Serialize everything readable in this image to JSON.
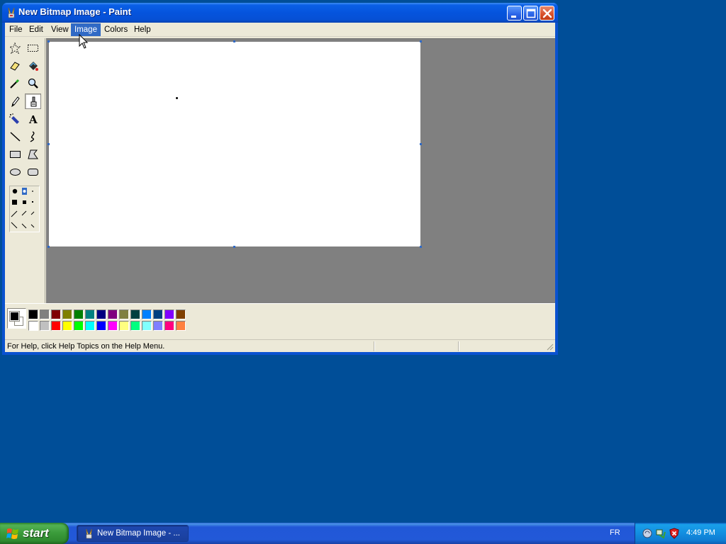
{
  "window": {
    "title": "New Bitmap Image - Paint"
  },
  "menu": {
    "items": [
      "File",
      "Edit",
      "View",
      "Image",
      "Colors",
      "Help"
    ],
    "active": "Image"
  },
  "tools": [
    "free-form-select",
    "select",
    "eraser",
    "fill-with-color",
    "pick-color",
    "magnifier",
    "pencil",
    "brush",
    "airbrush",
    "text",
    "line",
    "curve",
    "rectangle",
    "polygon",
    "ellipse",
    "rounded-rectangle"
  ],
  "selected_tool": "brush",
  "colors": {
    "foreground": "#000000",
    "background": "#ffffff",
    "palette_top": [
      "#000000",
      "#808080",
      "#800000",
      "#808000",
      "#008000",
      "#008080",
      "#000080",
      "#800080",
      "#808040",
      "#004040",
      "#0080ff",
      "#004080",
      "#8000ff",
      "#804000"
    ],
    "palette_bottom": [
      "#ffffff",
      "#c0c0c0",
      "#ff0000",
      "#ffff00",
      "#00ff00",
      "#00ffff",
      "#0000ff",
      "#ff00ff",
      "#ffff80",
      "#00ff80",
      "#80ffff",
      "#8080ff",
      "#ff0080",
      "#ff8040"
    ]
  },
  "status": {
    "help_text": "For Help, click Help Topics on the Help Menu."
  },
  "taskbar": {
    "start_label": "start",
    "task_label": "New Bitmap Image - ...",
    "language": "FR",
    "clock": "4:49 PM"
  }
}
